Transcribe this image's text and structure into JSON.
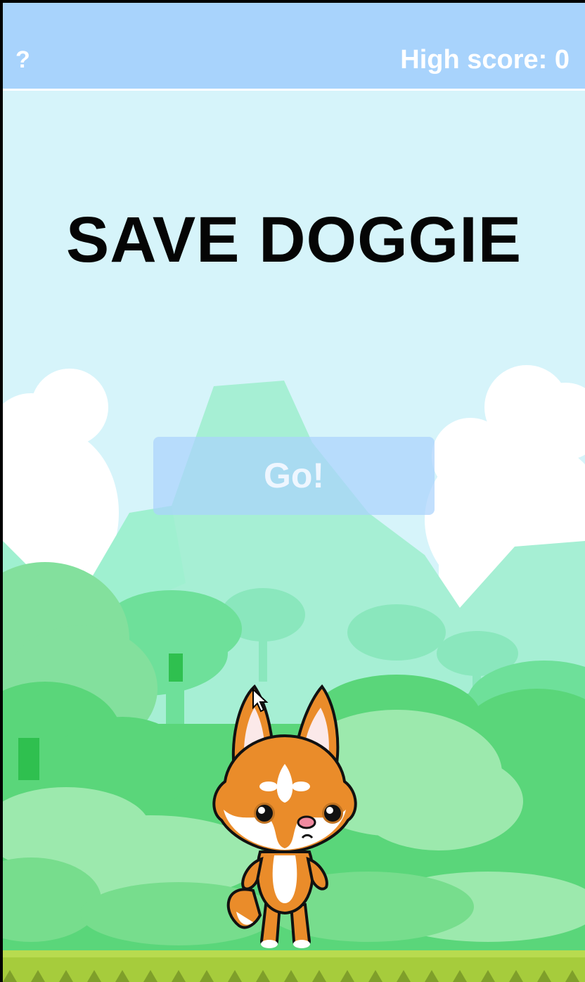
{
  "header": {
    "help_label": "?",
    "high_score_text": "High score: 0"
  },
  "game": {
    "title": "SAVE DOGGIE",
    "start_label": "Go!"
  },
  "icons": {
    "help": "question-mark-icon",
    "character": "fox-dog-character",
    "pointer": "mouse-pointer-icon"
  },
  "colors": {
    "sky": "#d6f4fa",
    "header": "#a8d3fc",
    "foliage": "#5ad67a",
    "ground": "#a6cc3c"
  }
}
